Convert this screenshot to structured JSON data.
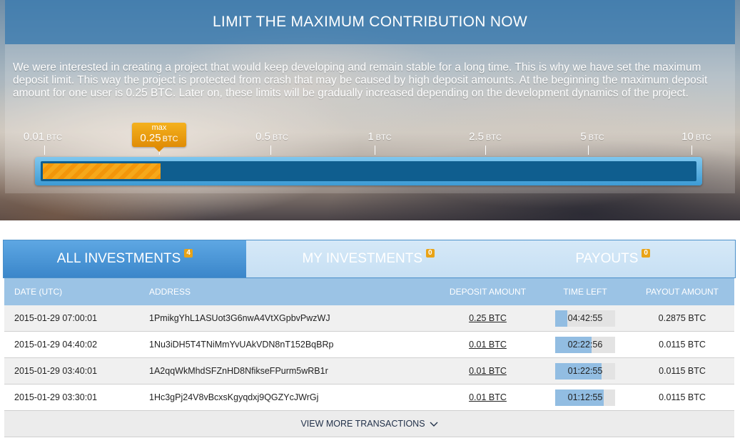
{
  "hero": {
    "title": "LIMIT THE MAXIMUM CONTRIBUTION NOW",
    "description": "We were interested in creating a project that would keep developing and remain stable for a long time. This is why we have set the maximum deposit limit. This way the project is protected from crash that may be caused by high deposit amounts. At the beginning the maximum deposit amount for one user is 0.25 BTC. Later on, these limits will be gradually increased depending on the development dynamics of the project.",
    "scale": [
      {
        "value": "0.01",
        "unit": "BTC"
      },
      {
        "value": "0.25",
        "unit": "BTC"
      },
      {
        "value": "0.5",
        "unit": "BTC"
      },
      {
        "value": "1",
        "unit": "BTC"
      },
      {
        "value": "2.5",
        "unit": "BTC"
      },
      {
        "value": "5",
        "unit": "BTC"
      },
      {
        "value": "10",
        "unit": "BTC"
      }
    ],
    "max_badge": {
      "word": "max",
      "value": "0.25",
      "unit": "BTC"
    },
    "progress_fraction": 0.18
  },
  "tabs": [
    {
      "label": "ALL INVESTMENTS",
      "count": "4",
      "active": true
    },
    {
      "label": "MY INVESTMENTS",
      "count": "0",
      "active": false
    },
    {
      "label": "PAYOUTS",
      "count": "0",
      "active": false
    }
  ],
  "table": {
    "headers": {
      "date": "DATE (UTC)",
      "address": "ADDRESS",
      "deposit": "DEPOSIT AMOUNT",
      "time_left": "TIME LEFT",
      "payout": "PAYOUT AMOUNT"
    },
    "rows": [
      {
        "date": "2015-01-29 07:00:01",
        "address": "1PmikgYhL1ASUot3G6nwA4VtXGpbvPwzWJ",
        "deposit": "0.25 BTC",
        "time_left": "04:42:55",
        "time_fraction": 0.2,
        "payout": "0.2875 BTC"
      },
      {
        "date": "2015-01-29 04:40:02",
        "address": "1Nu3iDH5T4TNiMmYvUAkVDN8nT152BqBRp",
        "deposit": "0.01 BTC",
        "time_left": "02:22:56",
        "time_fraction": 0.61,
        "payout": "0.0115 BTC"
      },
      {
        "date": "2015-01-29 03:40:01",
        "address": "1A2qqWkMhdSFZnHD8NfikseFPurm5wRB1r",
        "deposit": "0.01 BTC",
        "time_left": "01:22:55",
        "time_fraction": 0.77,
        "payout": "0.0115 BTC"
      },
      {
        "date": "2015-01-29 03:30:01",
        "address": "1Hc3gPj24V8vBcxsKgyqdxj9QGZYcJWrGj",
        "deposit": "0.01 BTC",
        "time_left": "01:12:55",
        "time_fraction": 0.81,
        "payout": "0.0115 BTC"
      }
    ],
    "view_more": "VIEW MORE TRANSACTIONS"
  },
  "colors": {
    "accent_blue": "#3a86ca",
    "badge_orange": "#e9a317",
    "progress_fill": "#f6a81a",
    "header_blue": "#9bc3e5"
  }
}
